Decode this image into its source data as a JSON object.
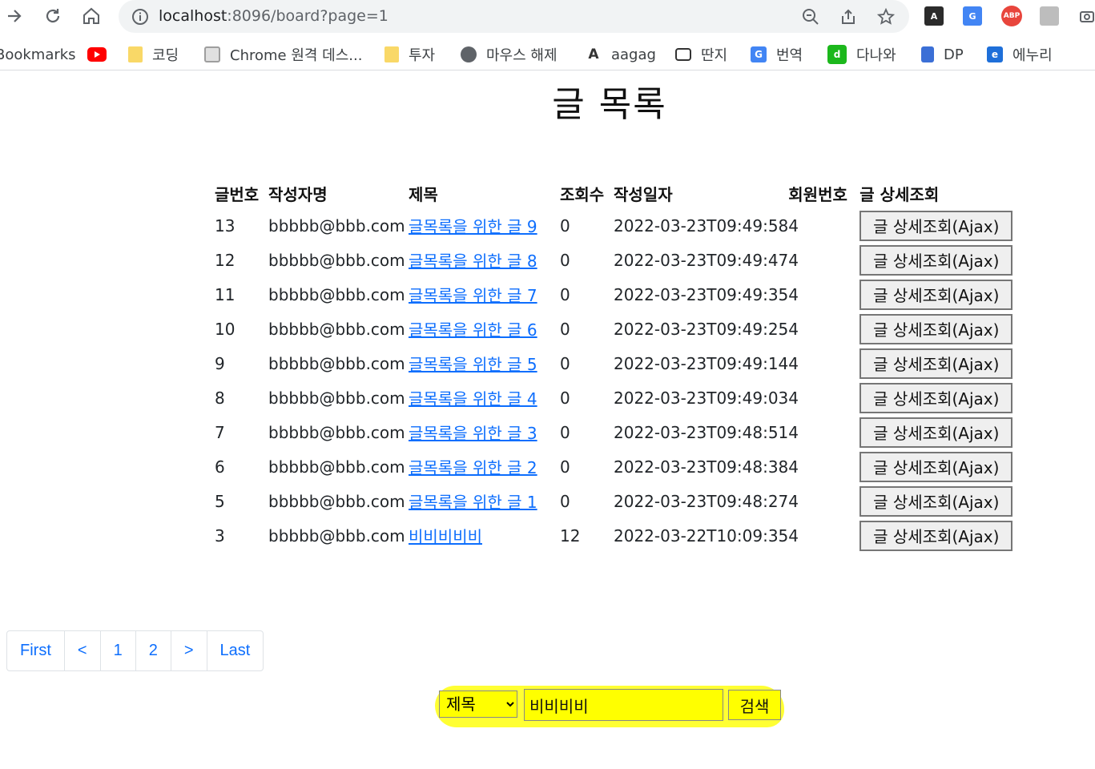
{
  "browser": {
    "url_host": "localhost",
    "url_rest": ":8096/board?page=1",
    "bookmarks": [
      {
        "label": "Bookmarks",
        "icon": "none"
      },
      {
        "label": "",
        "icon": "youtube-icon"
      },
      {
        "label": "코딩",
        "icon": "folder-icon"
      },
      {
        "label": "Chrome 원격 데스...",
        "icon": "chrome-remote-icon"
      },
      {
        "label": "투자",
        "icon": "folder-icon"
      },
      {
        "label": "마우스 해제",
        "icon": "globe-icon"
      },
      {
        "label": "aagag",
        "icon": "aagag-icon"
      },
      {
        "label": "딴지",
        "icon": "ddanzi-icon"
      },
      {
        "label": "번역",
        "icon": "translate-icon"
      },
      {
        "label": "다나와",
        "icon": "danawa-icon"
      },
      {
        "label": "DP",
        "icon": "dp-icon"
      },
      {
        "label": "에누리",
        "icon": "enuri-icon"
      }
    ],
    "ext_abp": "ABP"
  },
  "page": {
    "title": "글 목록"
  },
  "table": {
    "headers": [
      "글번호",
      "작성자명",
      "제목",
      "조회수",
      "작성일자",
      "회원번호",
      "글 상세조회"
    ],
    "rows": [
      {
        "no": "13",
        "writer": "bbbbb@bbb.com",
        "title": "글목록을 위한 글 9",
        "views": "0",
        "date": "2022-03-23T09:49:58",
        "member": "4",
        "action": "글 상세조회(Ajax)"
      },
      {
        "no": "12",
        "writer": "bbbbb@bbb.com",
        "title": "글목록을 위한 글 8",
        "views": "0",
        "date": "2022-03-23T09:49:47",
        "member": "4",
        "action": "글 상세조회(Ajax)"
      },
      {
        "no": "11",
        "writer": "bbbbb@bbb.com",
        "title": "글목록을 위한 글 7",
        "views": "0",
        "date": "2022-03-23T09:49:35",
        "member": "4",
        "action": "글 상세조회(Ajax)"
      },
      {
        "no": "10",
        "writer": "bbbbb@bbb.com",
        "title": "글목록을 위한 글 6",
        "views": "0",
        "date": "2022-03-23T09:49:25",
        "member": "4",
        "action": "글 상세조회(Ajax)"
      },
      {
        "no": "9",
        "writer": "bbbbb@bbb.com",
        "title": "글목록을 위한 글 5",
        "views": "0",
        "date": "2022-03-23T09:49:14",
        "member": "4",
        "action": "글 상세조회(Ajax)"
      },
      {
        "no": "8",
        "writer": "bbbbb@bbb.com",
        "title": "글목록을 위한 글 4",
        "views": "0",
        "date": "2022-03-23T09:49:03",
        "member": "4",
        "action": "글 상세조회(Ajax)"
      },
      {
        "no": "7",
        "writer": "bbbbb@bbb.com",
        "title": "글목록을 위한 글 3",
        "views": "0",
        "date": "2022-03-23T09:48:51",
        "member": "4",
        "action": "글 상세조회(Ajax)"
      },
      {
        "no": "6",
        "writer": "bbbbb@bbb.com",
        "title": "글목록을 위한 글 2",
        "views": "0",
        "date": "2022-03-23T09:48:38",
        "member": "4",
        "action": "글 상세조회(Ajax)"
      },
      {
        "no": "5",
        "writer": "bbbbb@bbb.com",
        "title": "글목록을 위한 글 1",
        "views": "0",
        "date": "2022-03-23T09:48:27",
        "member": "4",
        "action": "글 상세조회(Ajax)"
      },
      {
        "no": "3",
        "writer": "bbbbb@bbb.com",
        "title": "비비비비비",
        "views": "12",
        "date": "2022-03-22T10:09:35",
        "member": "4",
        "action": "글 상세조회(Ajax)"
      }
    ]
  },
  "pagination": [
    "First",
    "<",
    "1",
    "2",
    ">",
    "Last"
  ],
  "search": {
    "select_value": "제목",
    "input_value": "비비비비",
    "button_label": "검색"
  },
  "colors": {
    "link": "#0d6efd",
    "highlight": "#ffff00",
    "abp": "#e8453c",
    "danawa": "#1cb81c"
  }
}
